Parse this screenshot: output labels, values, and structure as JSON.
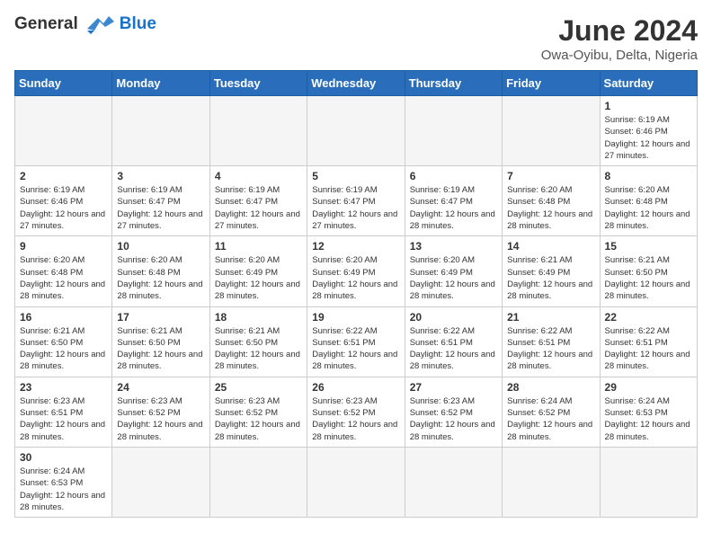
{
  "header": {
    "logo_general": "General",
    "logo_blue": "Blue",
    "title": "June 2024",
    "subtitle": "Owa-Oyibu, Delta, Nigeria"
  },
  "days_of_week": [
    "Sunday",
    "Monday",
    "Tuesday",
    "Wednesday",
    "Thursday",
    "Friday",
    "Saturday"
  ],
  "weeks": [
    [
      {
        "day": "",
        "empty": true
      },
      {
        "day": "",
        "empty": true
      },
      {
        "day": "",
        "empty": true
      },
      {
        "day": "",
        "empty": true
      },
      {
        "day": "",
        "empty": true
      },
      {
        "day": "",
        "empty": true
      },
      {
        "day": "1",
        "sunrise": "6:19 AM",
        "sunset": "6:46 PM",
        "daylight": "12 hours and 27 minutes."
      }
    ],
    [
      {
        "day": "2",
        "sunrise": "6:19 AM",
        "sunset": "6:46 PM",
        "daylight": "12 hours and 27 minutes."
      },
      {
        "day": "3",
        "sunrise": "6:19 AM",
        "sunset": "6:47 PM",
        "daylight": "12 hours and 27 minutes."
      },
      {
        "day": "4",
        "sunrise": "6:19 AM",
        "sunset": "6:47 PM",
        "daylight": "12 hours and 27 minutes."
      },
      {
        "day": "5",
        "sunrise": "6:19 AM",
        "sunset": "6:47 PM",
        "daylight": "12 hours and 27 minutes."
      },
      {
        "day": "6",
        "sunrise": "6:19 AM",
        "sunset": "6:47 PM",
        "daylight": "12 hours and 28 minutes."
      },
      {
        "day": "7",
        "sunrise": "6:20 AM",
        "sunset": "6:48 PM",
        "daylight": "12 hours and 28 minutes."
      },
      {
        "day": "8",
        "sunrise": "6:20 AM",
        "sunset": "6:48 PM",
        "daylight": "12 hours and 28 minutes."
      }
    ],
    [
      {
        "day": "9",
        "sunrise": "6:20 AM",
        "sunset": "6:48 PM",
        "daylight": "12 hours and 28 minutes."
      },
      {
        "day": "10",
        "sunrise": "6:20 AM",
        "sunset": "6:48 PM",
        "daylight": "12 hours and 28 minutes."
      },
      {
        "day": "11",
        "sunrise": "6:20 AM",
        "sunset": "6:49 PM",
        "daylight": "12 hours and 28 minutes."
      },
      {
        "day": "12",
        "sunrise": "6:20 AM",
        "sunset": "6:49 PM",
        "daylight": "12 hours and 28 minutes."
      },
      {
        "day": "13",
        "sunrise": "6:20 AM",
        "sunset": "6:49 PM",
        "daylight": "12 hours and 28 minutes."
      },
      {
        "day": "14",
        "sunrise": "6:21 AM",
        "sunset": "6:49 PM",
        "daylight": "12 hours and 28 minutes."
      },
      {
        "day": "15",
        "sunrise": "6:21 AM",
        "sunset": "6:50 PM",
        "daylight": "12 hours and 28 minutes."
      }
    ],
    [
      {
        "day": "16",
        "sunrise": "6:21 AM",
        "sunset": "6:50 PM",
        "daylight": "12 hours and 28 minutes."
      },
      {
        "day": "17",
        "sunrise": "6:21 AM",
        "sunset": "6:50 PM",
        "daylight": "12 hours and 28 minutes."
      },
      {
        "day": "18",
        "sunrise": "6:21 AM",
        "sunset": "6:50 PM",
        "daylight": "12 hours and 28 minutes."
      },
      {
        "day": "19",
        "sunrise": "6:22 AM",
        "sunset": "6:51 PM",
        "daylight": "12 hours and 28 minutes."
      },
      {
        "day": "20",
        "sunrise": "6:22 AM",
        "sunset": "6:51 PM",
        "daylight": "12 hours and 28 minutes."
      },
      {
        "day": "21",
        "sunrise": "6:22 AM",
        "sunset": "6:51 PM",
        "daylight": "12 hours and 28 minutes."
      },
      {
        "day": "22",
        "sunrise": "6:22 AM",
        "sunset": "6:51 PM",
        "daylight": "12 hours and 28 minutes."
      }
    ],
    [
      {
        "day": "23",
        "sunrise": "6:23 AM",
        "sunset": "6:51 PM",
        "daylight": "12 hours and 28 minutes."
      },
      {
        "day": "24",
        "sunrise": "6:23 AM",
        "sunset": "6:52 PM",
        "daylight": "12 hours and 28 minutes."
      },
      {
        "day": "25",
        "sunrise": "6:23 AM",
        "sunset": "6:52 PM",
        "daylight": "12 hours and 28 minutes."
      },
      {
        "day": "26",
        "sunrise": "6:23 AM",
        "sunset": "6:52 PM",
        "daylight": "12 hours and 28 minutes."
      },
      {
        "day": "27",
        "sunrise": "6:23 AM",
        "sunset": "6:52 PM",
        "daylight": "12 hours and 28 minutes."
      },
      {
        "day": "28",
        "sunrise": "6:24 AM",
        "sunset": "6:52 PM",
        "daylight": "12 hours and 28 minutes."
      },
      {
        "day": "29",
        "sunrise": "6:24 AM",
        "sunset": "6:53 PM",
        "daylight": "12 hours and 28 minutes."
      }
    ],
    [
      {
        "day": "30",
        "sunrise": "6:24 AM",
        "sunset": "6:53 PM",
        "daylight": "12 hours and 28 minutes."
      },
      {
        "day": "",
        "empty": true
      },
      {
        "day": "",
        "empty": true
      },
      {
        "day": "",
        "empty": true
      },
      {
        "day": "",
        "empty": true
      },
      {
        "day": "",
        "empty": true
      },
      {
        "day": "",
        "empty": true
      }
    ]
  ],
  "labels": {
    "sunrise": "Sunrise:",
    "sunset": "Sunset:",
    "daylight": "Daylight:"
  }
}
